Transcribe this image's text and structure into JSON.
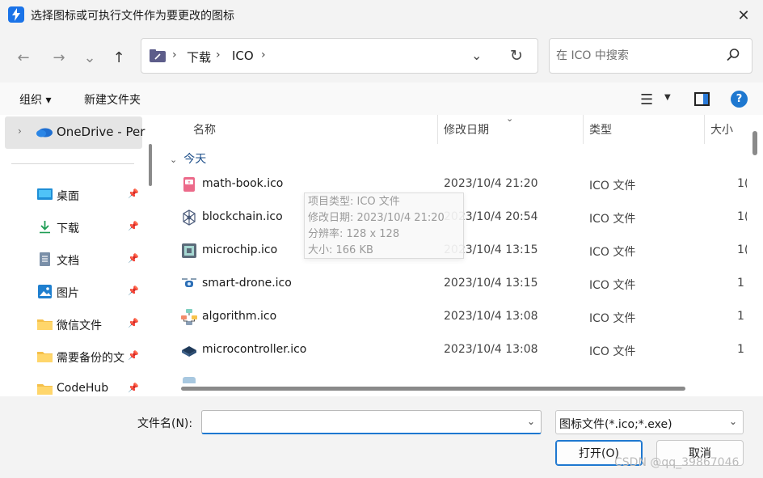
{
  "window": {
    "title": "选择图标或可执行文件作为要更改的图标",
    "close_glyph": "✕"
  },
  "nav": {
    "back_glyph": "←",
    "forward_glyph": "→",
    "recent_glyph": "⌄",
    "up_glyph": "↑"
  },
  "address": {
    "segments": [
      "下载",
      "ICO"
    ],
    "separator": "›",
    "dropdown_glyph": "⌄",
    "refresh_glyph": "↻"
  },
  "search": {
    "placeholder": "在 ICO 中搜索"
  },
  "toolbar": {
    "organize_label": "组织 ▾",
    "new_folder_label": "新建文件夹",
    "view_glyph": "☰",
    "view_caret": "▼",
    "help_label": "?"
  },
  "sidebar": {
    "onedrive_label": "OneDrive - Per",
    "expand_glyph": "›",
    "pin_glyph": "📌",
    "items": [
      {
        "label": "桌面",
        "icon": "desktop-icon",
        "pinned": true
      },
      {
        "label": "下载",
        "icon": "download-icon",
        "pinned": true
      },
      {
        "label": "文档",
        "icon": "document-icon",
        "pinned": true
      },
      {
        "label": "图片",
        "icon": "pictures-icon",
        "pinned": true
      },
      {
        "label": "微信文件",
        "icon": "folder-icon",
        "pinned": true
      },
      {
        "label": "需要备份的文",
        "icon": "folder-icon",
        "pinned": true
      },
      {
        "label": "CodeHub",
        "icon": "folder-icon",
        "pinned": true
      }
    ]
  },
  "columns": {
    "name": "名称",
    "modified": "修改日期",
    "type": "类型",
    "size": "大小"
  },
  "group": {
    "label": "今天",
    "chevron": "⌄"
  },
  "files": [
    {
      "name": "math-book.ico",
      "modified": "2023/10/4 21:20",
      "type": "ICO 文件",
      "size": "1(",
      "icon": "math-book-icon"
    },
    {
      "name": "blockchain.ico",
      "modified": "2023/10/4 20:54",
      "type": "ICO 文件",
      "size": "1(",
      "icon": "blockchain-icon"
    },
    {
      "name": "microchip.ico",
      "modified": "2023/10/4 13:15",
      "type": "ICO 文件",
      "size": "1(",
      "icon": "microchip-icon"
    },
    {
      "name": "smart-drone.ico",
      "modified": "2023/10/4 13:15",
      "type": "ICO 文件",
      "size": "1",
      "icon": "smart-drone-icon"
    },
    {
      "name": "algorithm.ico",
      "modified": "2023/10/4 13:08",
      "type": "ICO 文件",
      "size": "1",
      "icon": "algorithm-icon"
    },
    {
      "name": "microcontroller.ico",
      "modified": "2023/10/4 13:08",
      "type": "ICO 文件",
      "size": "1",
      "icon": "microcontroller-icon"
    }
  ],
  "tooltip": {
    "lines": [
      "项目类型: ICO 文件",
      "修改日期: 2023/10/4 21:20",
      "分辨率: 128 x 128",
      "大小: 166 KB"
    ]
  },
  "footer": {
    "filename_label": "文件名(N):",
    "filename_value": "",
    "filename_caret": "⌄",
    "filetype_value": "图标文件(*.ico;*.exe)",
    "filetype_caret": "⌄",
    "open_label": "打开(O)",
    "cancel_label": "取消",
    "watermark": "CSDN @qq_39867046"
  },
  "colors": {
    "accent": "#1e78d0",
    "title_bg": "#f3f3f3",
    "selected_bg": "#e5e5e5"
  }
}
